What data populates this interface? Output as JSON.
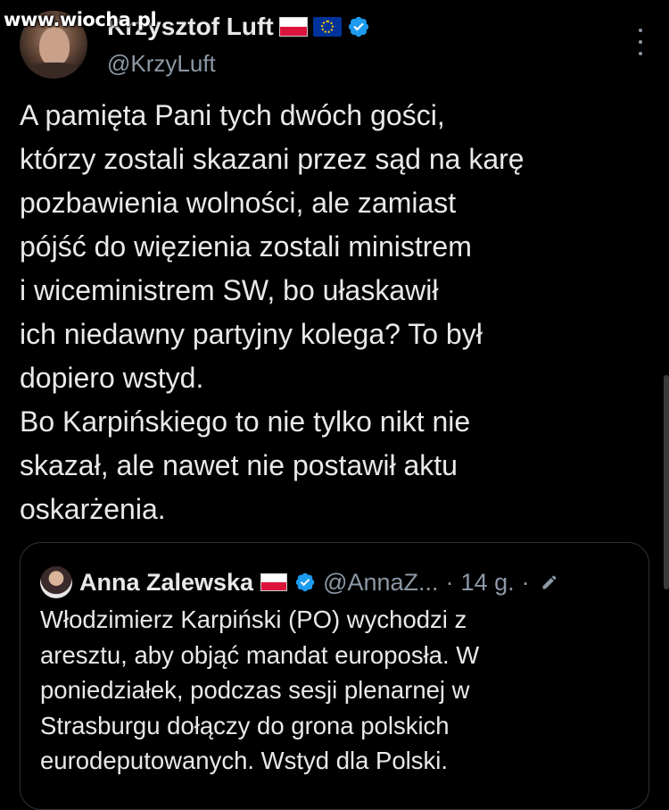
{
  "watermark": "www.wiocha.pl",
  "author": {
    "name": "Krzysztof Luft",
    "handle": "@KrzyLuft",
    "badges": [
      "flag-poland-icon",
      "flag-eu-icon",
      "verified-badge-icon"
    ]
  },
  "tweet": {
    "lines": [
      "A pamięta Pani tych dwóch gości,",
      "którzy zostali skazani przez sąd na karę",
      "pozbawienia wolności, ale zamiast",
      "pójść do więzienia zostali ministrem",
      "i wiceministrem SW, bo ułaskawił",
      "ich niedawny partyjny kolega? To był",
      "dopiero wstyd.",
      "Bo Karpińskiego to nie tylko nikt nie",
      "skazał, ale nawet nie postawił aktu",
      "oskarżenia."
    ]
  },
  "quote": {
    "name": "Anna Zalewska",
    "handle": "@AnnaZ...",
    "separator": "·",
    "time": "14 g.",
    "separator2": "·",
    "lines": [
      "Włodzimierz Karpiński (PO) wychodzi z",
      "aresztu, aby objąć mandat europosła. W",
      "poniedziałek, podczas sesji plenarnej w",
      "Strasburgu dołączy do grona polskich",
      "eurodeputowanych. Wstyd dla Polski."
    ]
  },
  "colors": {
    "background": "#000000",
    "text": "#e7e9ea",
    "secondary": "#8b98a5",
    "verified": "#1d9bf0",
    "border": "#2f3336"
  }
}
